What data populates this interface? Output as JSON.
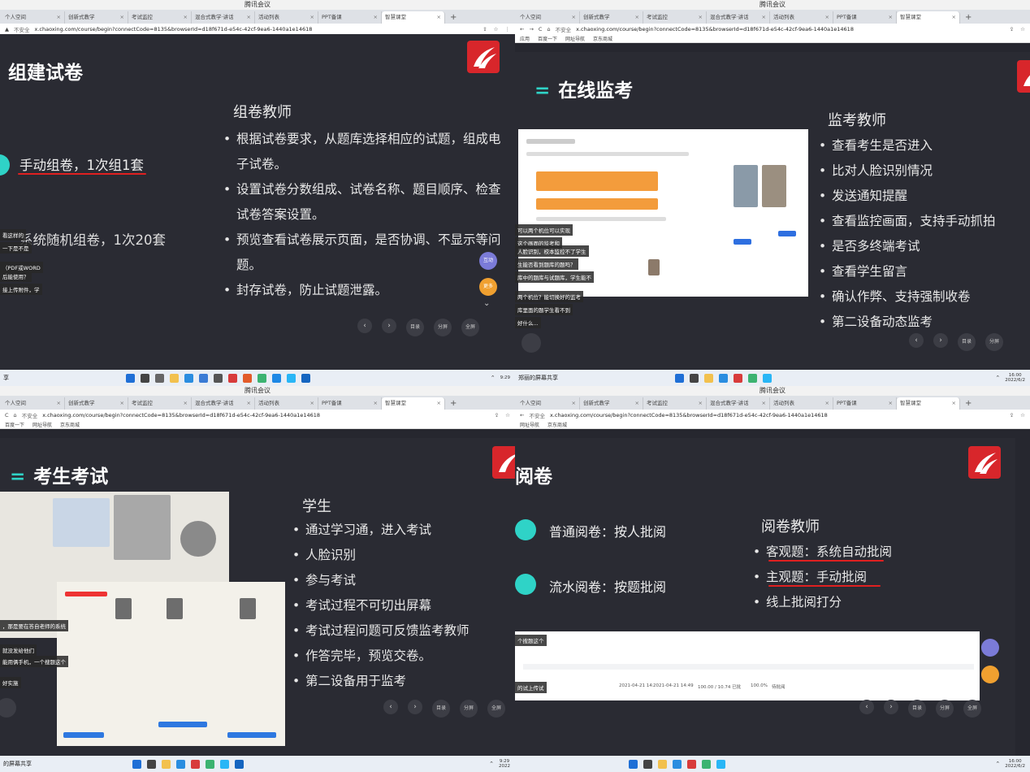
{
  "meeting_title": "腾讯会议",
  "tabs": [
    "个人空间",
    "创新式教学",
    "考试监控",
    "混合式教学·讲话",
    "活动列表",
    "PPT备课",
    "智慧课堂"
  ],
  "url": "x.chaoxing.com/course/begin?connectCode=8135&browserId=d18f671d-e54c-42cf-9ea6-1440a1e14618",
  "insecure_label": "不安全",
  "bookmarks": [
    "应用",
    "百度一下",
    "网址导航",
    "京东商城"
  ],
  "slide_nav": {
    "catalog": "目录",
    "split": "分屏",
    "full": "全屏"
  },
  "screen_share_label": "的屏幕共享",
  "q1": {
    "title": "组建试卷",
    "option1": "手动组卷，1次组1套",
    "option2": "系统随机组卷，1次20套",
    "role": "组卷教师",
    "bullets": [
      "根据试卷要求，从题库选择相应的试题，组成电子试卷。",
      "设置试卷分数组成、试卷名称、题目顺序、检查试卷答案设置。",
      "预览查看试卷展示页面，是否协调、不显示等问题。",
      "封存试卷，防止试题泄露。"
    ],
    "chat": [
      "看这样的",
      "一下是不是",
      "（PDF或WORD",
      "后能使用？",
      "接上传附件，学"
    ],
    "float_btns": [
      "互动",
      "更多"
    ],
    "clock": "9:29"
  },
  "q2": {
    "title": "在线监考",
    "role": "监考教师",
    "bullets": [
      "查看考生是否进入",
      "比对人脸识别情况",
      "发送通知提醒",
      "查看监控画面，支持手动抓拍",
      "是否多终端考试",
      "查看学生留言",
      "确认作弊、支持强制收卷",
      "第二设备动态监考"
    ],
    "chat": [
      "可以两个机位可以实现",
      "这个画面的监考和",
      "人脸识别，校本监控不了学生",
      "生能否看到题库的题吗？",
      "库中的题库与试题库，学生能不",
      "两个机位？能切换好的监考",
      "库里面的题学生看不到",
      "好什么..."
    ],
    "share_label": "郑丽的屏幕共享",
    "clock": "16:00",
    "date": "2022/6/2"
  },
  "q3": {
    "title": "考生考试",
    "role": "学生",
    "bullets": [
      "通过学习通，进入考试",
      "人脸识别",
      "参与考试",
      "考试过程不可切出屏幕",
      "考试过程问题可反馈监考教师",
      "作答完毕，预览交卷。",
      "第二设备用于监考"
    ],
    "chat": [
      "，那是要在答自老师的系统",
      "就没发给他们",
      "能用俩手机，一个搜题这个",
      "好实施"
    ],
    "share_label": "的屏幕共享",
    "clock": "9:29",
    "date": "2022"
  },
  "q4": {
    "title": "阅卷",
    "option1": "普通阅卷：按人批阅",
    "option2": "流水阅卷：按题批阅",
    "role": "阅卷教师",
    "bullets": [
      "客观题：系统自动批阅",
      "主观题：手动批阅",
      "线上批阅打分"
    ],
    "chat": [
      "个搜题这个",
      "的试上传试"
    ],
    "table_row": [
      "2021-04-21 14:",
      "2021-04-21 14:49",
      "100.00 / 10.74 已批",
      "100.0%",
      "待批阅"
    ],
    "clock": "16:00",
    "date": "2022/6/2"
  },
  "colors": {
    "accent": "#2fd3c7",
    "logo_red": "#d8262b",
    "underline": "#e02020",
    "slide_bg": "#2a2b33"
  }
}
